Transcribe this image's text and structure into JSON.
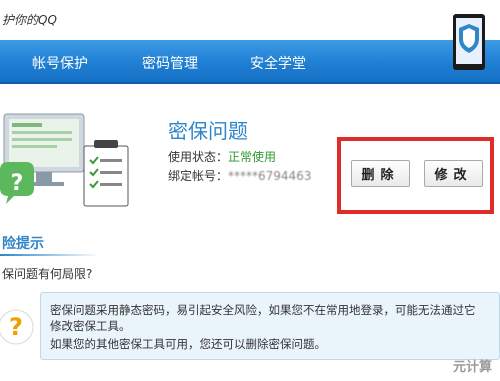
{
  "header": {
    "title": "护你的QQ"
  },
  "nav": {
    "tabs": [
      {
        "label": "帐号保护"
      },
      {
        "label": "密码管理"
      },
      {
        "label": "安全学堂"
      }
    ]
  },
  "mibao": {
    "title": "密保问题",
    "status_label": "使用状态：",
    "status_value": "正常使用",
    "account_label": "绑定帐号：",
    "account_value": "*****6794463"
  },
  "actions": {
    "delete_label": "删除",
    "modify_label": "修改"
  },
  "risk": {
    "title": "险提示",
    "question": "保问题有何局限?"
  },
  "notice": {
    "line1": "密保问题采用静态密码，易引起安全风险，如果您不在常用地登录，可能无法通过它",
    "line2": "修改密保工具。",
    "line3": "如果您的其他密保工具可用，您还可以删除密保问题。"
  },
  "watermark": "元计算"
}
